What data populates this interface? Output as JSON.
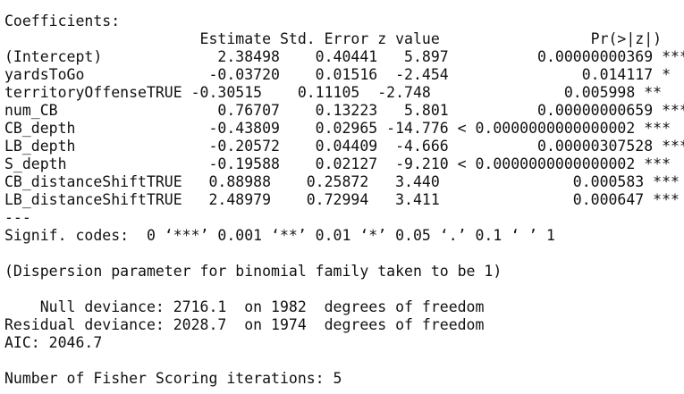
{
  "output": {
    "coef_header": "Coefficients:",
    "col_header": "                      Estimate Std. Error z value                 Pr(>|z|)    ",
    "rows": [
      "(Intercept)             2.38498    0.40441   5.897          0.00000000369 ***",
      "yardsToGo              -0.03720    0.01516  -2.454               0.014117 *  ",
      "territoryOffenseTRUE -0.30515    0.11105  -2.748               0.005998 ** ",
      "num_CB                  0.76707    0.13223   5.801          0.00000000659 ***",
      "CB_depth               -0.43809    0.02965 -14.776 < 0.0000000000000002 ***",
      "LB_depth               -0.20572    0.04409  -4.666          0.00000307528 ***",
      "S_depth                -0.19588    0.02127  -9.210 < 0.0000000000000002 ***",
      "CB_distanceShiftTRUE   0.88988    0.25872   3.440               0.000583 ***",
      "LB_distanceShiftTRUE   2.48979    0.72994   3.411               0.000647 ***"
    ],
    "separator": "---",
    "signif_codes": "Signif. codes:  0 ‘***’ 0.001 ‘**’ 0.01 ‘*’ 0.05 ‘.’ 0.1 ‘ ’ 1",
    "dispersion": "(Dispersion parameter for binomial family taken to be 1)",
    "null_deviance": "    Null deviance: 2716.1  on 1982  degrees of freedom",
    "residual_deviance": "Residual deviance: 2028.7  on 1974  degrees of freedom",
    "aic": "AIC: 2046.7",
    "fisher": "Number of Fisher Scoring iterations: 5"
  }
}
